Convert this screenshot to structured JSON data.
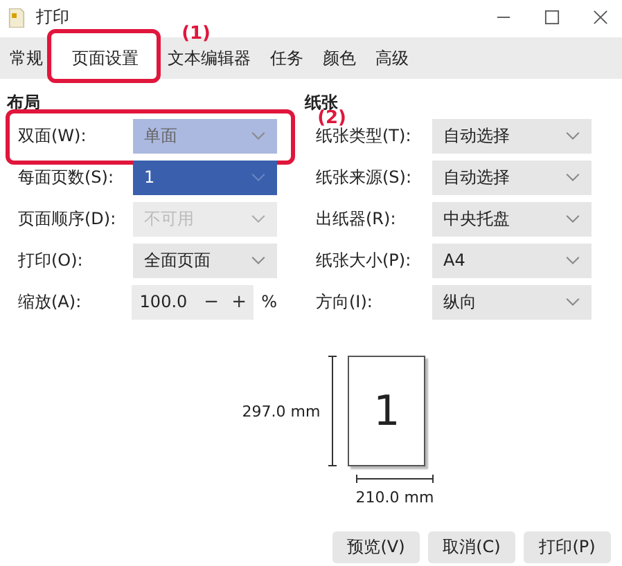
{
  "window": {
    "title": "打印"
  },
  "tabs": [
    {
      "label": "常规",
      "selected": false
    },
    {
      "label": "页面设置",
      "selected": true,
      "callout": "(1)"
    },
    {
      "label": "文本编辑器",
      "selected": false
    },
    {
      "label": "任务",
      "selected": false
    },
    {
      "label": "颜色",
      "selected": false
    },
    {
      "label": "高级",
      "selected": false
    }
  ],
  "layout": {
    "heading": "布局",
    "rows": [
      {
        "kind": "select",
        "label": "双面(W):",
        "value": "单面",
        "hovered": true,
        "selected": false,
        "disabled": false,
        "callout": "(2)"
      },
      {
        "kind": "select",
        "label": "每面页数(S):",
        "value": "1",
        "hovered": false,
        "selected": true,
        "disabled": false
      },
      {
        "kind": "select",
        "label": "页面顺序(D):",
        "value": "不可用",
        "hovered": false,
        "selected": false,
        "disabled": true
      },
      {
        "kind": "select",
        "label": "打印(O):",
        "value": "全面页面",
        "hovered": false,
        "selected": false,
        "disabled": false
      },
      {
        "kind": "spin",
        "label": "缩放(A):",
        "value": "100.0",
        "minus": "−",
        "plus": "+",
        "unit": "%"
      }
    ]
  },
  "paper": {
    "heading": "纸张",
    "rows": [
      {
        "kind": "select",
        "label": "纸张类型(T):",
        "value": "自动选择",
        "hovered": false,
        "selected": false,
        "disabled": false
      },
      {
        "kind": "select",
        "label": "纸张来源(S):",
        "value": "自动选择",
        "hovered": false,
        "selected": false,
        "disabled": false
      },
      {
        "kind": "select",
        "label": "出纸器(R):",
        "value": "中央托盘",
        "hovered": false,
        "selected": false,
        "disabled": false
      },
      {
        "kind": "select",
        "label": "纸张大小(P):",
        "value": "A4",
        "hovered": false,
        "selected": false,
        "disabled": false
      },
      {
        "kind": "select",
        "label": "方向(I):",
        "value": "纵向",
        "hovered": false,
        "selected": false,
        "disabled": false
      }
    ]
  },
  "preview": {
    "page": "1",
    "height": "297.0 mm",
    "width": "210.0 mm"
  },
  "buttons": [
    "预览(V)",
    "取消(C)",
    "打印(P)"
  ]
}
